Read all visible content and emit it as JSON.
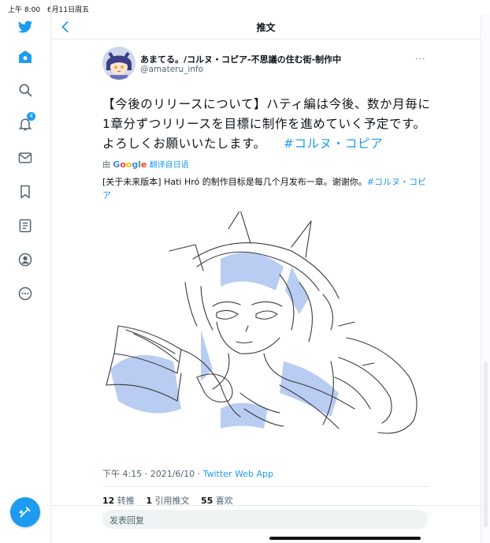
{
  "status_bar": {
    "time": "上午 8:00",
    "date": "6月11日周五"
  },
  "sidebar": {
    "items": [
      {
        "icon": "twitter-logo-icon"
      },
      {
        "icon": "home-icon"
      },
      {
        "icon": "search-icon"
      },
      {
        "icon": "notifications-icon",
        "badge": "4"
      },
      {
        "icon": "messages-icon"
      },
      {
        "icon": "bookmarks-icon"
      },
      {
        "icon": "lists-icon"
      },
      {
        "icon": "profile-icon"
      },
      {
        "icon": "more-icon"
      }
    ],
    "compose_icon": "compose-tweet-icon"
  },
  "header": {
    "title": "推文"
  },
  "tweet": {
    "author_name": "あまてる。/コルヌ・コピア-不思議の住む街-制作中",
    "author_handle": "@amateru_info",
    "text": "【今後のリリースについて】ハティ編は今後、数か月毎に1章分ずつリリースを目標に制作を進めていく予定です。よろしくお願いいたします。",
    "hashtag": "#コルヌ・コピア",
    "translate_prefix": "由",
    "translate_brand": "Google",
    "translate_action": "翻译自日语",
    "translation": "[关于未来版本] Hati Hró 的制作目标是每几个月发布一章。谢谢你。",
    "translation_hashtag": "#コルヌ・コピア",
    "time": "下午 4:15",
    "date": "2021/6/10",
    "separator": "·",
    "source": "Twitter Web App",
    "retweets_count": "12",
    "retweets_label": "转推",
    "quotes_count": "1",
    "quotes_label": "引用推文",
    "likes_count": "55",
    "likes_label": "喜欢"
  },
  "reply": {
    "placeholder": "发表回复"
  },
  "colors": {
    "accent": "#1d9bf0",
    "text": "#0f1419",
    "secondary": "#536471",
    "divider": "#e6ecf0"
  }
}
